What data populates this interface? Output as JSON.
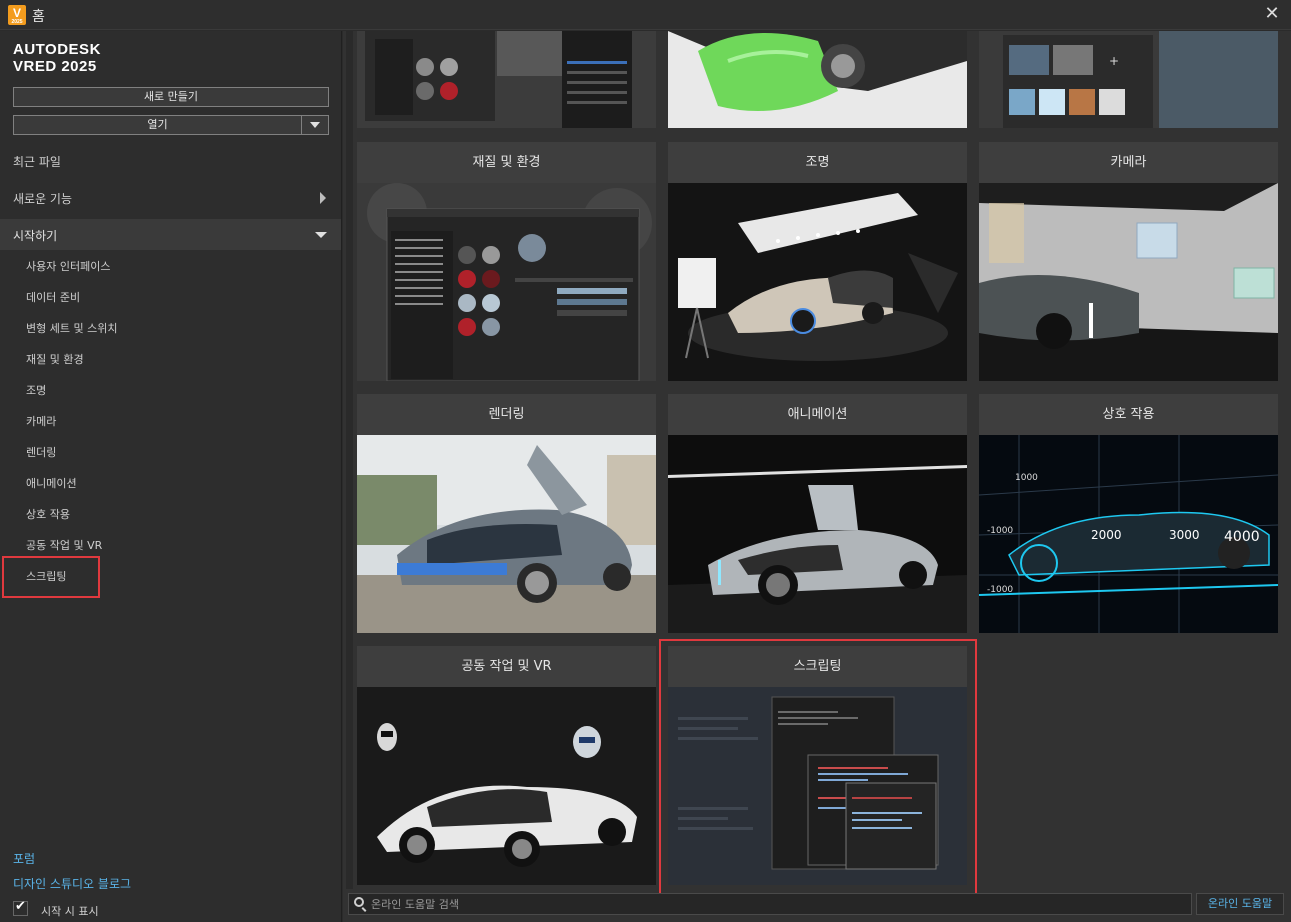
{
  "window": {
    "title": "홈",
    "app_icon_letter": "V",
    "app_icon_sub": "2025"
  },
  "brand": {
    "line1": "AUTODESK",
    "line2": "VRED 2025"
  },
  "actions": {
    "new_label": "새로 만들기",
    "open_label": "열기"
  },
  "nav": {
    "recent_files": "최근 파일",
    "whats_new": "새로운 기능",
    "getting_started": "시작하기",
    "sub_items": [
      "사용자 인터페이스",
      "데이터 준비",
      "변형 세트 및 스위치",
      "재질 및 환경",
      "조명",
      "카메라",
      "렌더링",
      "애니메이션",
      "상호 작용",
      "공동 작업 및 VR",
      "스크립팅"
    ],
    "highlighted_item": "스크립팅"
  },
  "links": {
    "forum": "포럼",
    "blog": "디자인 스튜디오 블로그"
  },
  "show_on_start": {
    "label": "시작 시 표시",
    "checked": true
  },
  "tiles": [
    {
      "caption": "재질 및 환경"
    },
    {
      "caption": "조명"
    },
    {
      "caption": "카메라"
    },
    {
      "caption": "렌더링"
    },
    {
      "caption": "애니메이션"
    },
    {
      "caption": "상호 작용"
    },
    {
      "caption": "공동 작업 및 VR"
    },
    {
      "caption": "스크립팅"
    }
  ],
  "interaction_axis_labels": [
    "1000",
    "-1000",
    "2000",
    "3000",
    "4000",
    "-1000"
  ],
  "search": {
    "placeholder": "온라인 도움말 검색",
    "value": ""
  },
  "help_button": "온라인 도움말",
  "colors": {
    "accent_link": "#5ab4e8",
    "highlight_red": "#e0393e",
    "app_icon": "#f39c1e"
  }
}
